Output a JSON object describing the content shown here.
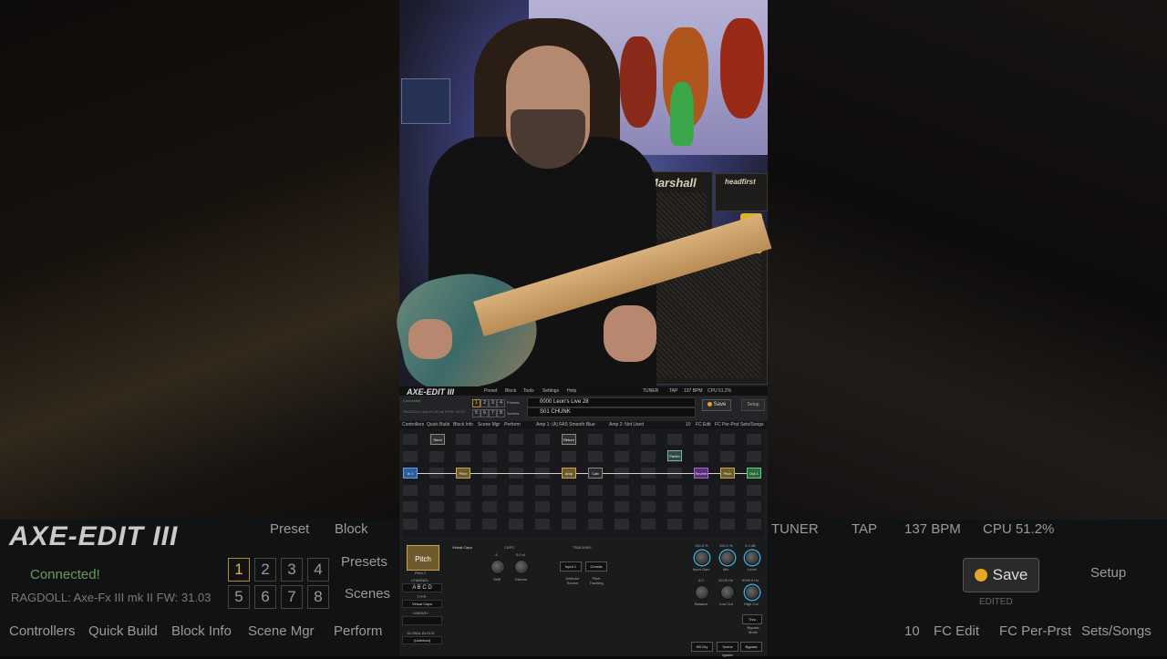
{
  "background": {
    "logo_text": "AXE-EDIT III",
    "menu_items": [
      "Preset",
      "Block"
    ],
    "status": [
      "TUNER",
      "TAP",
      "137 BPM",
      "CPU 51.2%"
    ],
    "connection": "Connected!",
    "device": "RAGDOLL: Axe-Fx III mk II FW: 31.03",
    "presets_label": "Presets",
    "scenes_label": "Scenes",
    "bottom_tabs": [
      "Controllers",
      "Quick Build",
      "Block Info",
      "Scene Mgr",
      "Perform"
    ],
    "right_tabs": [
      "10",
      "FC Edit",
      "FC Per-Prst",
      "Sets/Songs"
    ],
    "save_label": "Save",
    "setup_label": "Setup",
    "edited_label": "EDITED",
    "numbers": [
      "1",
      "2",
      "3",
      "4",
      "5",
      "6",
      "7",
      "8"
    ]
  },
  "video": {
    "amp_logo": "Marshall",
    "amp2_logo": "headfirst"
  },
  "ui": {
    "logo_text": "AXE-EDIT III",
    "menu": [
      "Preset",
      "Block",
      "Tools",
      "Settings",
      "Help"
    ],
    "status": [
      "TUNER",
      "TAP",
      "137 BPM",
      "CPU 51.2%"
    ],
    "connection": "Connected",
    "device": "RAGDOLL: Axe-Fx III mk II FW: 31.03",
    "numbers": [
      "1",
      "2",
      "3",
      "4",
      "5",
      "6",
      "7",
      "8"
    ],
    "presets_label": "Presets",
    "scenes_label": "Scenes",
    "preset_number": "0000",
    "preset_name": "Leon's Live 28",
    "scene_number": "S01",
    "scene_name": "CHUNK",
    "save_label": "Save",
    "setup_label": "Setup",
    "tabs": [
      "Controllers",
      "Quick Build",
      "Block Info",
      "Scene Mgr",
      "Perform"
    ],
    "amp1": "Amp 1: (A) FAS Smooth Blue",
    "amp2": "Amp 2: Not Used",
    "right_tabs": [
      "10",
      "FC Edit",
      "FC Per-Prst",
      "Sets/Songs"
    ],
    "blocks": {
      "send": "Send",
      "return": "Return",
      "in1": "In 1",
      "pitch": "Pitch",
      "amp": "Amp",
      "cab": "Cab",
      "reverb": "Reverb",
      "pitch2": "Pitch",
      "out1": "Out 1",
      "parallel": "Parllm"
    },
    "editor": {
      "tile_label": "Pitch",
      "tile_sub": "Pitch 2",
      "channel_label": "CHANNEL",
      "channels": "A B C D",
      "type_label": "TYPE",
      "type_value": "Virtual Capo",
      "library_label": "LIBRARY",
      "global_label": "GLOBAL BLOCK",
      "global_value": "(Unlinked)",
      "page_tab": "Virtual Capo",
      "capo_label": "CAPO",
      "shift_value": "-4",
      "detune_value": "0.0 ct",
      "shift_label": "Shift",
      "detune_label": "Detune",
      "tracking_label": "TRACKING",
      "detector_value": "Input 1",
      "tracking_value": "Chords",
      "detector_label": "Detector Source",
      "pitch_tracking_label": "Pitch Tracking",
      "right_values": [
        "100.0 %",
        "100.0 %",
        "0.0 dB"
      ],
      "right_labels": [
        "Input Gain",
        "Mix",
        "Level"
      ],
      "right_values2": [
        "0.0",
        "20.00 Hz",
        "9999.9 Hz"
      ],
      "right_labels2": [
        "Balance",
        "Low Cut",
        "High Cut"
      ],
      "bypass_mode_value": "Thru",
      "bypass_mode_label": "Bypass Mode",
      "footer_buttons": [
        "Kill Dry",
        "Scene Ignore",
        "Bypass"
      ]
    }
  }
}
